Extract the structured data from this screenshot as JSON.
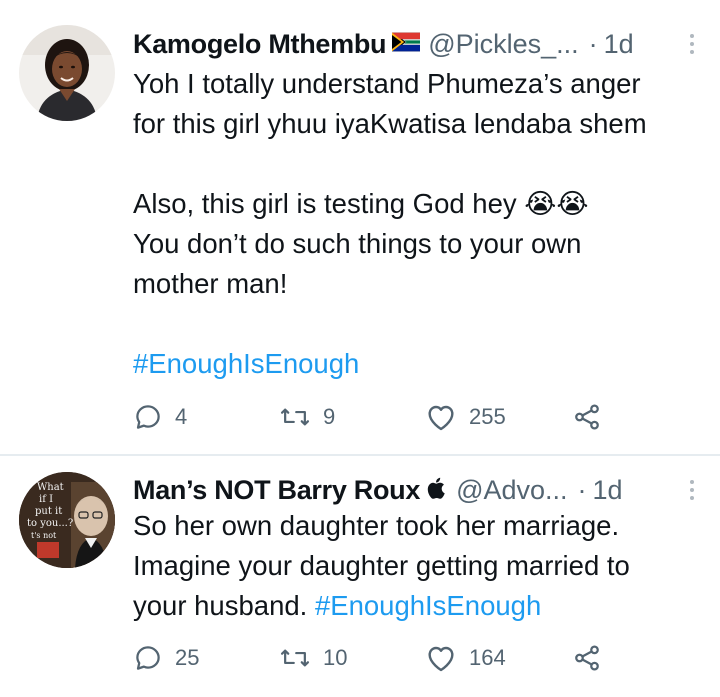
{
  "tweets": [
    {
      "author": {
        "name": "Kamogelo Mthembu",
        "handle": "@Pickles_...",
        "badge_icon": "south-africa-flag-icon"
      },
      "separator": "·",
      "time": "1d",
      "body_lines": [
        "Yoh I totally understand Phumeza’s anger",
        "for this girl yhuu iyaKwatisa lendaba shem",
        "",
        "Also, this girl is testing God hey 😭😭",
        "You don’t do such things to your own",
        "mother man!",
        ""
      ],
      "hashtag": "#EnoughIsEnough",
      "stats": {
        "replies": "4",
        "retweets": "9",
        "likes": "255"
      }
    },
    {
      "author": {
        "name": "Man’s NOT Barry Roux",
        "handle": "@Advo...",
        "badge_icon": "apple-icon"
      },
      "separator": "·",
      "time": "1d",
      "body_lines": [
        "So her own daughter took her marriage.",
        "Imagine your daughter getting married to"
      ],
      "last_line_text": "your husband. ",
      "hashtag": "#EnoughIsEnough",
      "stats": {
        "replies": "25",
        "retweets": "10",
        "likes": "164"
      }
    }
  ],
  "colors": {
    "text": "#0f1419",
    "muted": "#536471",
    "link": "#1d9bf0",
    "divider": "#e6ecf0"
  }
}
